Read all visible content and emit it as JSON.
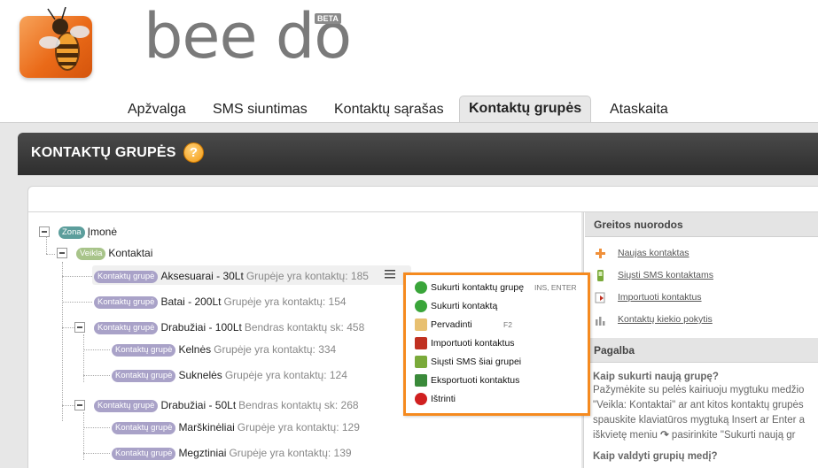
{
  "app": {
    "logo_text": "bee do",
    "beta_label": "BETA"
  },
  "nav": {
    "tabs": [
      {
        "label": "Apžvalga"
      },
      {
        "label": "SMS siuntimas"
      },
      {
        "label": "Kontaktų sąrašas"
      },
      {
        "label": "Kontaktų grupės"
      },
      {
        "label": "Ataskaita"
      }
    ],
    "active_tab": "Kontaktų grupės"
  },
  "page": {
    "title": "KONTAKTŲ GRUPĖS",
    "help_glyph": "?"
  },
  "tree": {
    "root": {
      "badge": "Zona",
      "name": "Įmonė"
    },
    "level1": {
      "badge": "Veikla",
      "name": "Kontaktai"
    },
    "groups": [
      {
        "badge": "Kontaktų grupė",
        "name": "Aksesuarai - 30Lt",
        "meta": "Grupėje yra kontaktų: 185"
      },
      {
        "badge": "Kontaktų grupė",
        "name": "Batai - 200Lt",
        "meta": "Grupėje yra kontaktų: 154"
      },
      {
        "badge": "Kontaktų grupė",
        "name": "Drabužiai - 100Lt",
        "meta": "Bendras kontaktų sk: 458"
      },
      {
        "badge": "Kontaktų grupė",
        "name": "Kelnės",
        "meta": "Grupėje yra kontaktų: 334"
      },
      {
        "badge": "Kontaktų grupė",
        "name": "Suknelės",
        "meta": "Grupėje yra kontaktų: 124"
      },
      {
        "badge": "Kontaktų grupė",
        "name": "Drabužiai - 50Lt",
        "meta": "Bendras kontaktų sk: 268"
      },
      {
        "badge": "Kontaktų grupė",
        "name": "Marškinėliai",
        "meta": "Grupėje yra kontaktų: 129"
      },
      {
        "badge": "Kontaktų grupė",
        "name": "Megztiniai",
        "meta": "Grupėje yra kontaktų: 139"
      }
    ]
  },
  "context_menu": {
    "items": [
      {
        "label": "Sukurti kontaktų grupę",
        "shortcut": "INS, ENTER",
        "icon": "add-icon"
      },
      {
        "label": "Sukurti kontaktą",
        "shortcut": "",
        "icon": "add-icon"
      },
      {
        "label": "Pervadinti",
        "shortcut": "F2",
        "icon": "edit-icon"
      },
      {
        "label": "Importuoti kontaktus",
        "shortcut": "",
        "icon": "import-icon"
      },
      {
        "label": "Siųsti SMS šiai grupei",
        "shortcut": "",
        "icon": "phone-icon"
      },
      {
        "label": "Eksportuoti kontaktus",
        "shortcut": "",
        "icon": "export-icon"
      },
      {
        "label": "Ištrinti",
        "shortcut": "",
        "icon": "delete-icon"
      }
    ]
  },
  "sidebar": {
    "quick_title": "Greitos nuorodos",
    "links": [
      {
        "label": "Naujas kontaktas",
        "icon": "add-contact-icon"
      },
      {
        "label": "Siųsti SMS kontaktams",
        "icon": "phone-icon"
      },
      {
        "label": "Importuoti kontaktus",
        "icon": "import-icon"
      },
      {
        "label": "Kontaktų kiekio pokytis",
        "icon": "chart-icon"
      }
    ],
    "help_title": "Pagalba",
    "help_q1": "Kaip sukurti naują grupę?",
    "help_p1_l1": "Pažymėkite su pelės kairiuoju mygtuku medžio",
    "help_p1_l2": "\"Veikla: Kontaktai\" ar ant kitos kontaktų grupės",
    "help_p1_l3": "spauskite klaviatūros mygtuką Insert ar Enter a",
    "help_p1_l4a": "iškvietę meniu",
    "help_p1_l4b": "pasirinkite \"Sukurti naują gr",
    "help_q2": "Kaip valdyti grupių medį?"
  },
  "colors": {
    "accent_orange": "#f58a1f",
    "badge_zona": "#5c9e9c",
    "badge_veikla": "#a8c48a",
    "badge_grupe": "#a9a2c8"
  }
}
